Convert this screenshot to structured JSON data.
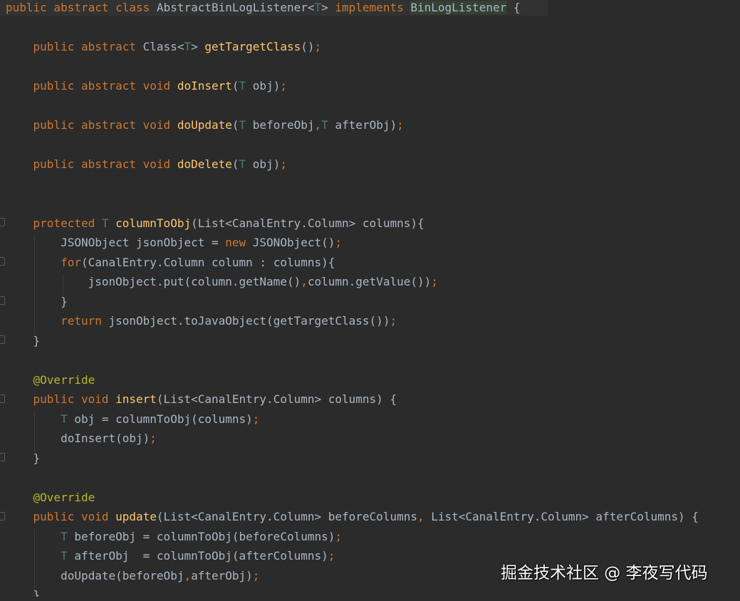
{
  "editor": {
    "lines": [
      [
        {
          "t": "public abstract class ",
          "c": "kw"
        },
        {
          "t": "AbstractBinLogListener<",
          "c": "pl"
        },
        {
          "t": "T",
          "c": "tp"
        },
        {
          "t": "> ",
          "c": "pl"
        },
        {
          "t": "implements ",
          "c": "kw"
        },
        {
          "t": "BinLogListener",
          "c": "hl"
        },
        {
          "t": " {",
          "c": "pl"
        }
      ],
      [],
      [
        {
          "t": "    public abstract ",
          "c": "kw"
        },
        {
          "t": "Class<",
          "c": "pl"
        },
        {
          "t": "T",
          "c": "tp"
        },
        {
          "t": "> ",
          "c": "pl"
        },
        {
          "t": "getTargetClass",
          "c": "fn"
        },
        {
          "t": "()",
          "c": "pl"
        },
        {
          "t": ";",
          "c": "kw"
        }
      ],
      [],
      [
        {
          "t": "    public abstract void ",
          "c": "kw"
        },
        {
          "t": "doInsert",
          "c": "fn"
        },
        {
          "t": "(",
          "c": "pl"
        },
        {
          "t": "T ",
          "c": "tp"
        },
        {
          "t": "obj)",
          "c": "pl"
        },
        {
          "t": ";",
          "c": "kw"
        }
      ],
      [],
      [
        {
          "t": "    public abstract void ",
          "c": "kw"
        },
        {
          "t": "doUpdate",
          "c": "fn"
        },
        {
          "t": "(",
          "c": "pl"
        },
        {
          "t": "T ",
          "c": "tp"
        },
        {
          "t": "beforeObj",
          "c": "pl"
        },
        {
          "t": ",",
          "c": "kw"
        },
        {
          "t": "T ",
          "c": "tp"
        },
        {
          "t": "afterObj)",
          "c": "pl"
        },
        {
          "t": ";",
          "c": "kw"
        }
      ],
      [],
      [
        {
          "t": "    public abstract void ",
          "c": "kw"
        },
        {
          "t": "doDelete",
          "c": "fn"
        },
        {
          "t": "(",
          "c": "pl"
        },
        {
          "t": "T ",
          "c": "tp"
        },
        {
          "t": "obj)",
          "c": "pl"
        },
        {
          "t": ";",
          "c": "kw"
        }
      ],
      [],
      [],
      [
        {
          "t": "    protected ",
          "c": "kw"
        },
        {
          "t": "T ",
          "c": "tp"
        },
        {
          "t": "columnToObj",
          "c": "fn"
        },
        {
          "t": "(List<CanalEntry.Column> columns){",
          "c": "pl"
        }
      ],
      [
        {
          "t": "        JSONObject jsonObject = ",
          "c": "pl"
        },
        {
          "t": "new ",
          "c": "kw"
        },
        {
          "t": "JSONObject()",
          "c": "pl"
        },
        {
          "t": ";",
          "c": "kw"
        }
      ],
      [
        {
          "t": "        for",
          "c": "kw"
        },
        {
          "t": "(CanalEntry.Column column : columns){",
          "c": "pl"
        }
      ],
      [
        {
          "t": "            jsonObject.put(column.getName()",
          "c": "pl"
        },
        {
          "t": ",",
          "c": "kw"
        },
        {
          "t": "column.getValue())",
          "c": "pl"
        },
        {
          "t": ";",
          "c": "kw"
        }
      ],
      [
        {
          "t": "        }",
          "c": "pl"
        }
      ],
      [
        {
          "t": "        return ",
          "c": "kw"
        },
        {
          "t": "jsonObject.toJavaObject(getTargetClass())",
          "c": "pl"
        },
        {
          "t": ";",
          "c": "kw"
        }
      ],
      [
        {
          "t": "    }",
          "c": "pl"
        }
      ],
      [],
      [
        {
          "t": "    @Override",
          "c": "an"
        }
      ],
      [
        {
          "t": "    public void ",
          "c": "kw"
        },
        {
          "t": "insert",
          "c": "fn"
        },
        {
          "t": "(List<CanalEntry.Column> columns) {",
          "c": "pl"
        }
      ],
      [
        {
          "t": "        T ",
          "c": "tp"
        },
        {
          "t": "obj = columnToObj(columns)",
          "c": "pl"
        },
        {
          "t": ";",
          "c": "kw"
        }
      ],
      [
        {
          "t": "        doInsert(obj)",
          "c": "pl"
        },
        {
          "t": ";",
          "c": "kw"
        }
      ],
      [
        {
          "t": "    }",
          "c": "pl"
        }
      ],
      [],
      [
        {
          "t": "    @Override",
          "c": "an"
        }
      ],
      [
        {
          "t": "    public void ",
          "c": "kw"
        },
        {
          "t": "update",
          "c": "fn"
        },
        {
          "t": "(List<CanalEntry.Column> beforeColumns",
          "c": "pl"
        },
        {
          "t": ", ",
          "c": "kw"
        },
        {
          "t": "List<CanalEntry.Column> afterColumns) {",
          "c": "pl"
        }
      ],
      [
        {
          "t": "        T ",
          "c": "tp"
        },
        {
          "t": "beforeObj = columnToObj(beforeColumns)",
          "c": "pl"
        },
        {
          "t": ";",
          "c": "kw"
        }
      ],
      [
        {
          "t": "        T ",
          "c": "tp"
        },
        {
          "t": "afterObj  = columnToObj(afterColumns)",
          "c": "pl"
        },
        {
          "t": ";",
          "c": "kw"
        }
      ],
      [
        {
          "t": "        doUpdate(beforeObj",
          "c": "pl"
        },
        {
          "t": ",",
          "c": "kw"
        },
        {
          "t": "afterObj)",
          "c": "pl"
        },
        {
          "t": ";",
          "c": "kw"
        }
      ],
      [
        {
          "t": "    }",
          "c": "pl"
        }
      ]
    ]
  },
  "watermark": {
    "text": "掘金技术社区 @ 李夜写代码"
  },
  "colors": {
    "background": "#2b2b2b",
    "keyword": "#cc7832",
    "method": "#ffc66d",
    "type_param": "#507874",
    "annotation": "#bbb529",
    "plain": "#a9b7c6"
  }
}
